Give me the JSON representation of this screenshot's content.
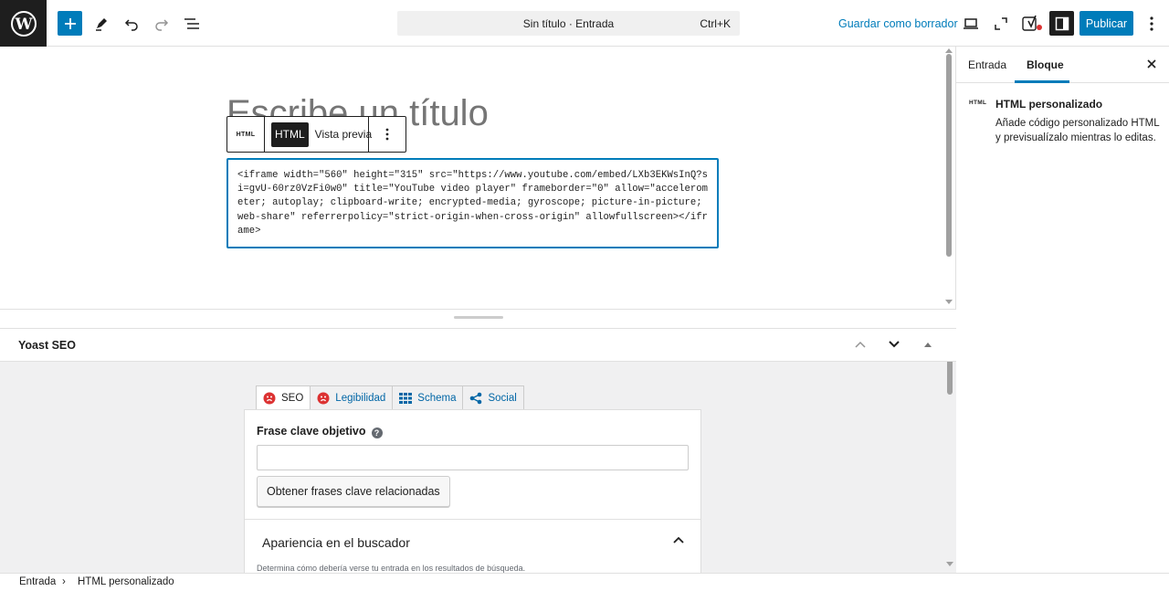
{
  "topbar": {
    "command_title": "Sin título · Entrada",
    "command_shortcut": "Ctrl+K",
    "save_draft_label": "Guardar como borrador",
    "publish_label": "Publicar",
    "icons": [
      "wordpress-logo-icon",
      "plus-icon",
      "pencil-icon",
      "undo-icon",
      "redo-icon",
      "list-view-icon",
      "desktop-preview-icon",
      "fullscreen-icon",
      "yoast-icon",
      "sidebar-icon",
      "more-vertical-icon"
    ]
  },
  "editor": {
    "title_placeholder": "Escribe un título",
    "block_toolbar": {
      "block_icon_label": "HTML",
      "html_tab": "HTML",
      "preview_tab": "Vista previa"
    },
    "code": "<iframe width=\"560\" height=\"315\" src=\"https://www.youtube.com/embed/LXb3EKWsInQ?si=gvU-60rz0VzFi0w0\" title=\"YouTube video player\" frameborder=\"0\" allow=\"accelerometer; autoplay; clipboard-write; encrypted-media; gyroscope; picture-in-picture; web-share\" referrerpolicy=\"strict-origin-when-cross-origin\" allowfullscreen></iframe>"
  },
  "metabox": {
    "title": "Yoast SEO",
    "tabs": [
      {
        "label": "SEO",
        "icon": "sad-face-icon",
        "active": true
      },
      {
        "label": "Legibilidad",
        "icon": "sad-face-icon",
        "active": false
      },
      {
        "label": "Schema",
        "icon": "grid-icon",
        "active": false
      },
      {
        "label": "Social",
        "icon": "share-icon",
        "active": false
      }
    ],
    "focus_keyphrase_label": "Frase clave objetivo",
    "focus_keyphrase_value": "",
    "related_button": "Obtener frases clave relacionadas",
    "appearance_title": "Apariencia en el buscador",
    "appearance_desc": "Determina cómo debería verse tu entrada en los resultados de búsqueda."
  },
  "sidebar": {
    "tab_post": "Entrada",
    "tab_block": "Bloque",
    "block_icon_label": "HTML",
    "block_title": "HTML personalizado",
    "block_desc": "Añade código personalizado HTML y previsualízalo mientras lo editas."
  },
  "footer": {
    "crumb_1": "Entrada",
    "crumb_sep": "›",
    "crumb_2": "HTML personalizado"
  },
  "colors": {
    "accent": "#007cba",
    "dark": "#1e1e1e",
    "yoast_red": "#dc3232"
  }
}
